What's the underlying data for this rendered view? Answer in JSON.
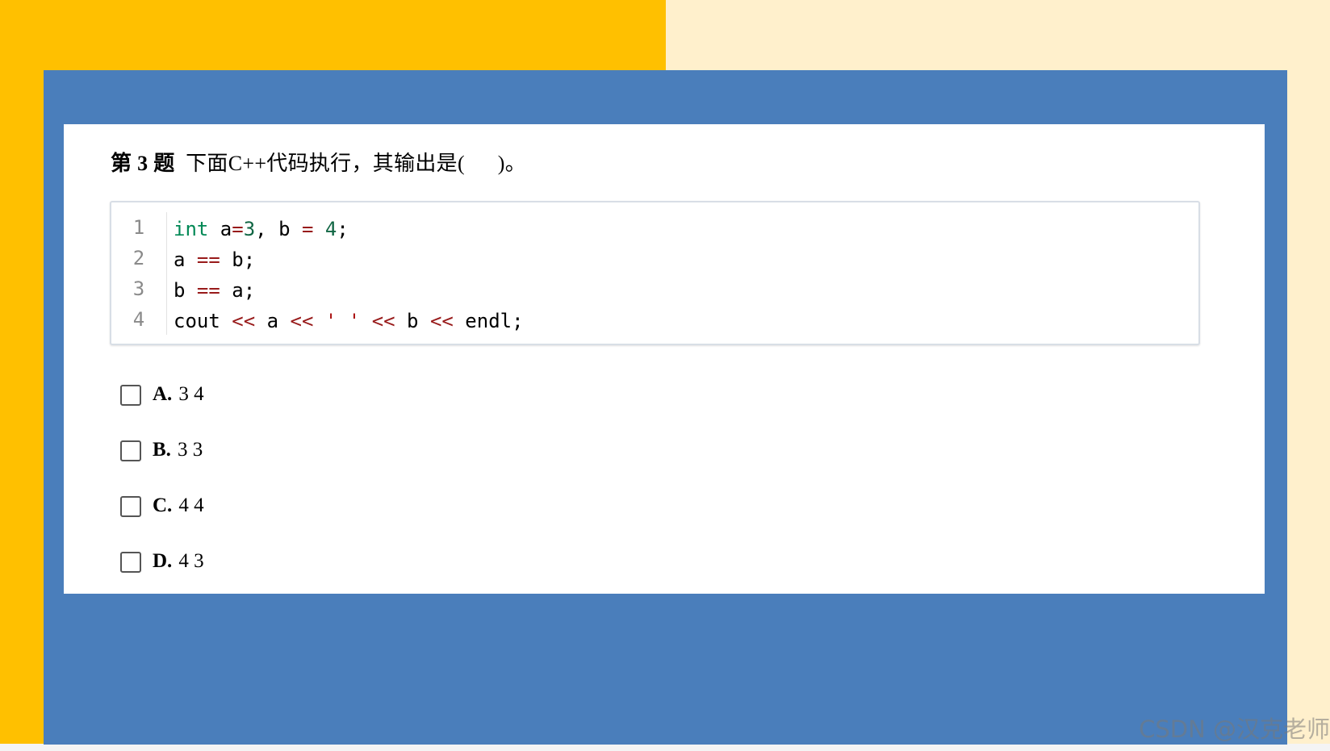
{
  "question": {
    "number_label": "第 3 题",
    "text": "下面C++代码执行，其输出是(      )。"
  },
  "code": {
    "line_numbers": [
      "1",
      "2",
      "3",
      "4"
    ],
    "lines": [
      [
        {
          "t": "int",
          "c": "kw"
        },
        {
          "t": " a",
          "c": "plain"
        },
        {
          "t": "=",
          "c": "op"
        },
        {
          "t": "3",
          "c": "num"
        },
        {
          "t": ", b ",
          "c": "plain"
        },
        {
          "t": "=",
          "c": "op"
        },
        {
          "t": " ",
          "c": "plain"
        },
        {
          "t": "4",
          "c": "num"
        },
        {
          "t": ";",
          "c": "plain"
        }
      ],
      [
        {
          "t": "a ",
          "c": "plain"
        },
        {
          "t": "==",
          "c": "op"
        },
        {
          "t": " b;",
          "c": "plain"
        }
      ],
      [
        {
          "t": "b ",
          "c": "plain"
        },
        {
          "t": "==",
          "c": "op"
        },
        {
          "t": " a;",
          "c": "plain"
        }
      ],
      [
        {
          "t": "cout ",
          "c": "plain"
        },
        {
          "t": "<<",
          "c": "op"
        },
        {
          "t": " a ",
          "c": "plain"
        },
        {
          "t": "<<",
          "c": "op"
        },
        {
          "t": " ",
          "c": "plain"
        },
        {
          "t": "' '",
          "c": "str"
        },
        {
          "t": " ",
          "c": "plain"
        },
        {
          "t": "<<",
          "c": "op"
        },
        {
          "t": " b ",
          "c": "plain"
        },
        {
          "t": "<<",
          "c": "op"
        },
        {
          "t": " endl;",
          "c": "plain"
        }
      ]
    ]
  },
  "options": [
    {
      "letter": "A.",
      "text": "3 4"
    },
    {
      "letter": "B.",
      "text": "3 3"
    },
    {
      "letter": "C.",
      "text": "4 4"
    },
    {
      "letter": "D.",
      "text": "4 3"
    }
  ],
  "watermark": "CSDN @汉克老师",
  "colors": {
    "yellow": "#FFC000",
    "cream": "#FFF0CC",
    "blue": "#4A7EBB",
    "keyword": "#008855",
    "number": "#116644",
    "operator": "#981A1A",
    "string": "#AA1111"
  }
}
